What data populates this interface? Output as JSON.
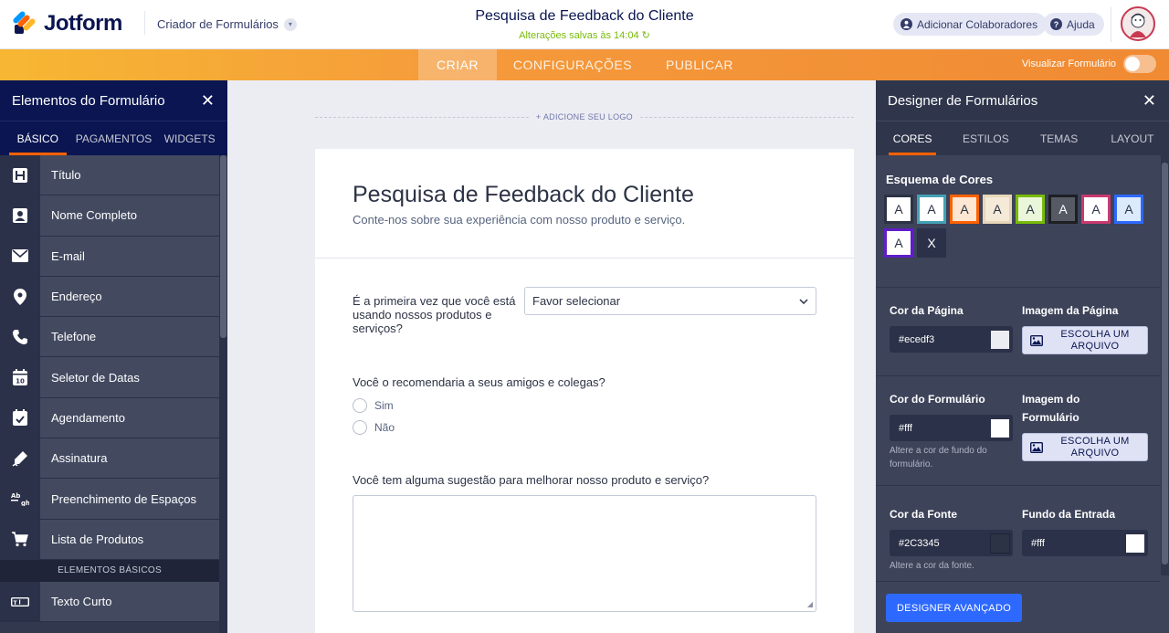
{
  "header": {
    "brand": "Jotform",
    "builder_label": "Criador de Formulários",
    "form_title": "Pesquisa de Feedback do Cliente",
    "saved_status": "Alterações salvas às 14:04 ↻",
    "add_collaborators": "Adicionar Colaboradores",
    "help": "Ajuda"
  },
  "nav": {
    "tabs": [
      {
        "label": "CRIAR"
      },
      {
        "label": "CONFIGURAÇÕES"
      },
      {
        "label": "PUBLICAR"
      }
    ],
    "preview_label": "Visualizar Formulário"
  },
  "left_panel": {
    "title": "Elementos do Formulário",
    "tabs": [
      {
        "label": "BÁSICO"
      },
      {
        "label": "PAGAMENTOS"
      },
      {
        "label": "WIDGETS"
      }
    ],
    "items": [
      {
        "label": "Título",
        "icon": "heading-icon"
      },
      {
        "label": "Nome Completo",
        "icon": "contact-card-icon"
      },
      {
        "label": "E-mail",
        "icon": "envelope-icon"
      },
      {
        "label": "Endereço",
        "icon": "map-pin-icon"
      },
      {
        "label": "Telefone",
        "icon": "phone-icon"
      },
      {
        "label": "Seletor de Datas",
        "icon": "calendar-icon"
      },
      {
        "label": "Agendamento",
        "icon": "calendar-check-icon"
      },
      {
        "label": "Assinatura",
        "icon": "pen-icon"
      },
      {
        "label": "Preenchimento de Espaços",
        "icon": "fill-blank-icon"
      },
      {
        "label": "Lista de Produtos",
        "icon": "cart-icon"
      }
    ],
    "section_label": "ELEMENTOS BÁSICOS",
    "extra_items": [
      {
        "label": "Texto Curto",
        "icon": "short-text-icon"
      }
    ]
  },
  "canvas": {
    "add_logo": "+ ADICIONE SEU LOGO",
    "form_heading": "Pesquisa de Feedback do Cliente",
    "form_subheading": "Conte-nos sobre sua experiência com nosso produto e serviço.",
    "q1_label": "É a primeira vez que você está usando nossos produtos e serviços?",
    "q1_select": "Favor selecionar",
    "q2_label": "Você o recomendaria a seus amigos e colegas?",
    "q2_options": [
      "Sim",
      "Não"
    ],
    "q3_label": "Você tem alguma sugestão para melhorar nosso produto e serviço?"
  },
  "right_panel": {
    "title": "Designer de Formulários",
    "tabs": [
      {
        "label": "CORES"
      },
      {
        "label": "ESTILOS"
      },
      {
        "label": "TEMAS"
      },
      {
        "label": "LAYOUT"
      }
    ],
    "scheme_label": "Esquema de Cores",
    "swatches": [
      {
        "letter": "A",
        "bg": "#ffffff",
        "border": "#2c3345",
        "color": "#2c3345"
      },
      {
        "letter": "A",
        "bg": "#ffffff",
        "border": "#43a1b5",
        "color": "#2c3345"
      },
      {
        "letter": "A",
        "bg": "#fde6d2",
        "border": "#ff6100",
        "color": "#2c3345"
      },
      {
        "letter": "A",
        "bg": "#f5ead8",
        "border": "#e7d6b8",
        "color": "#2c3345"
      },
      {
        "letter": "A",
        "bg": "#eaf6da",
        "border": "#78bb07",
        "color": "#2c3345"
      },
      {
        "letter": "A",
        "bg": "#555a65",
        "border": "#1e1f23",
        "color": "#ffffff"
      },
      {
        "letter": "A",
        "bg": "#ffffff",
        "border": "#c83a6f",
        "color": "#2c3345"
      },
      {
        "letter": "A",
        "bg": "#dcebfc",
        "border": "#2e69ff",
        "color": "#2c3345"
      },
      {
        "letter": "A",
        "bg": "#ffffff",
        "border": "#5f1ec8",
        "color": "#2c3345"
      }
    ],
    "swatch_clear": "X",
    "page_color_label": "Cor da Página",
    "page_color_value": "#ecedf3",
    "page_image_label": "Imagem da Página",
    "choose_file": "ESCOLHA UM ARQUIVO",
    "form_color_label": "Cor do Formulário",
    "form_color_value": "#fff",
    "form_color_help": "Altere a cor de fundo do formulário.",
    "form_image_label": "Imagem do Formulário",
    "font_color_label": "Cor da Fonte",
    "font_color_value": "#2C3345",
    "font_color_help": "Altere a cor da fonte.",
    "input_bg_label": "Fundo da Entrada",
    "input_bg_value": "#fff",
    "advanced_button": "DESIGNER AVANÇADO"
  },
  "colors": {
    "brand_navy": "#0a1551",
    "accent_orange": "#ff6100",
    "saved_green": "#78bb07",
    "advanced_blue": "#2e69ff",
    "page_chip": "#ecedf3",
    "form_chip": "#ffffff",
    "font_chip": "#2c3345",
    "input_chip": "#ffffff"
  }
}
